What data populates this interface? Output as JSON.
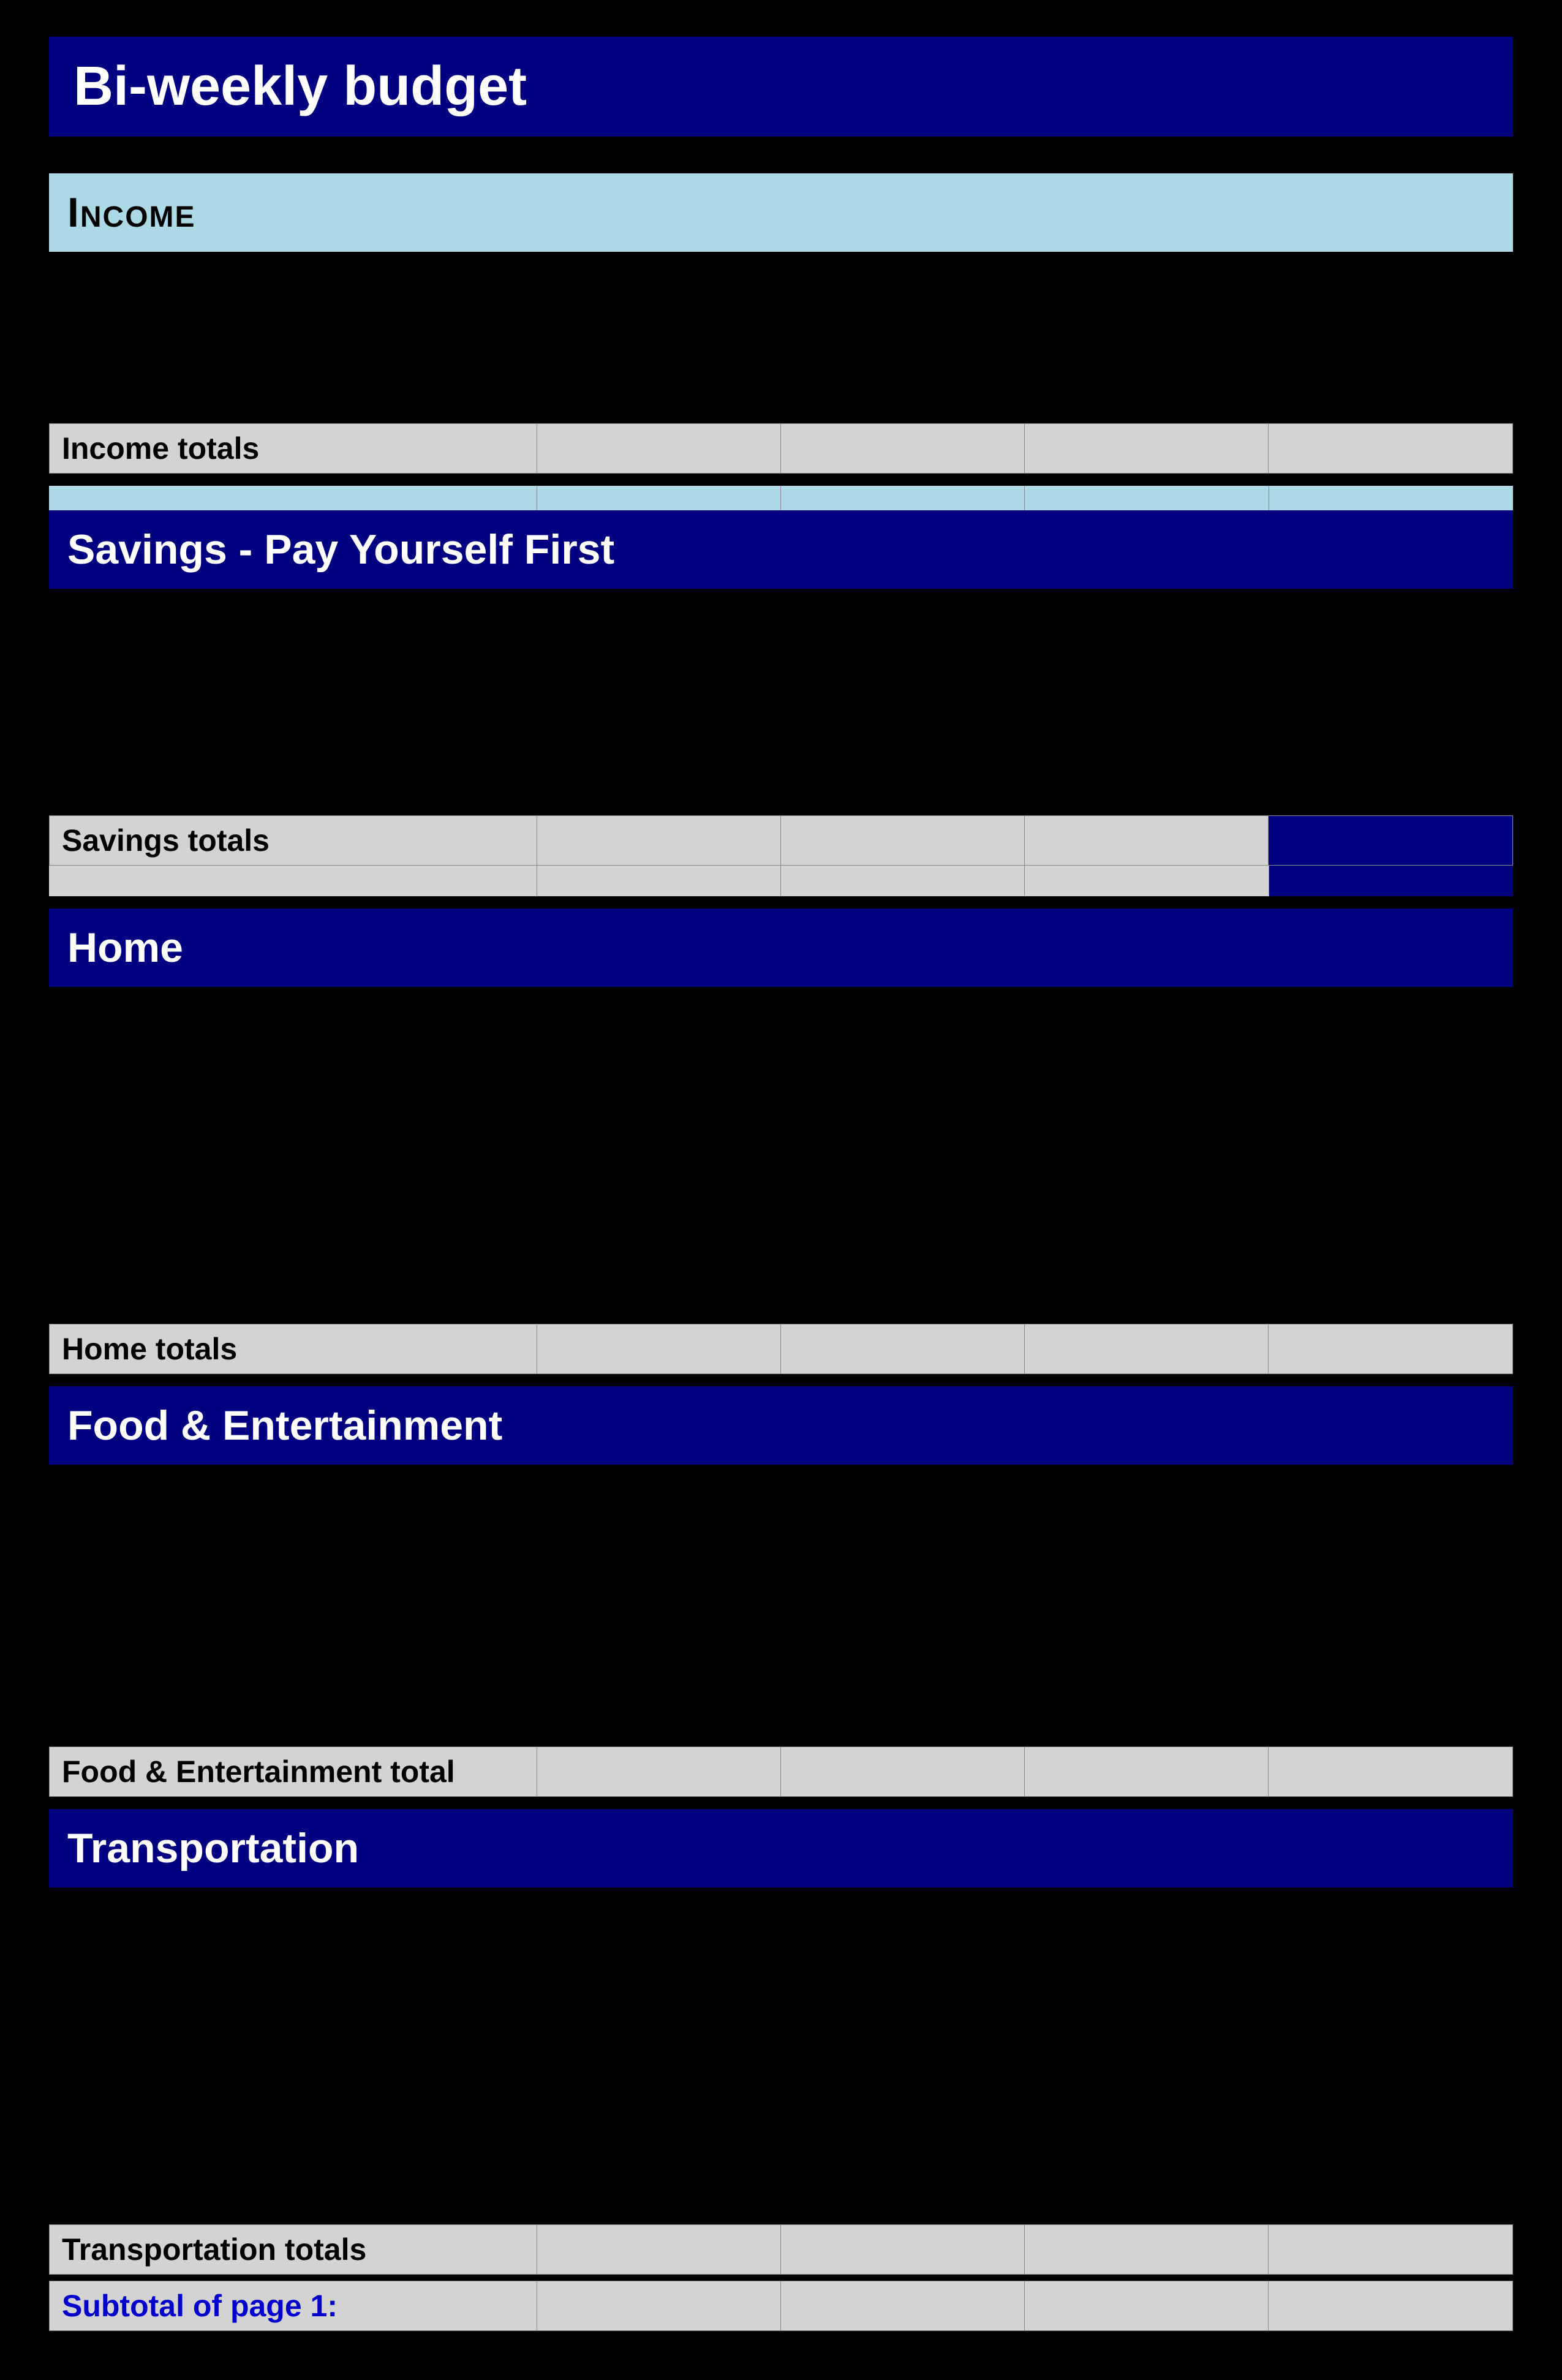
{
  "page": {
    "title": "Bi-weekly  budget",
    "background_color": "#000000"
  },
  "sections": {
    "income": {
      "header": "Income",
      "totals_label": "Income totals",
      "header_style": "light"
    },
    "savings": {
      "header": "Savings - Pay Yourself First",
      "totals_label": "Savings totals",
      "header_style": "dark"
    },
    "home": {
      "header": "Home",
      "totals_label": "Home totals",
      "header_style": "dark"
    },
    "food": {
      "header": "Food & Entertainment",
      "totals_label": "Food & Entertainment total",
      "header_style": "dark"
    },
    "transportation": {
      "header": "Transportation",
      "totals_label": "Transportation totals",
      "header_style": "dark"
    }
  },
  "subtotal": {
    "label": "Subtotal of page 1:"
  },
  "colors": {
    "dark_navy": "#000080",
    "light_blue": "#add8e6",
    "light_gray": "#d3d3d3",
    "black": "#000000",
    "white": "#ffffff",
    "blue_label": "#0000cc"
  }
}
